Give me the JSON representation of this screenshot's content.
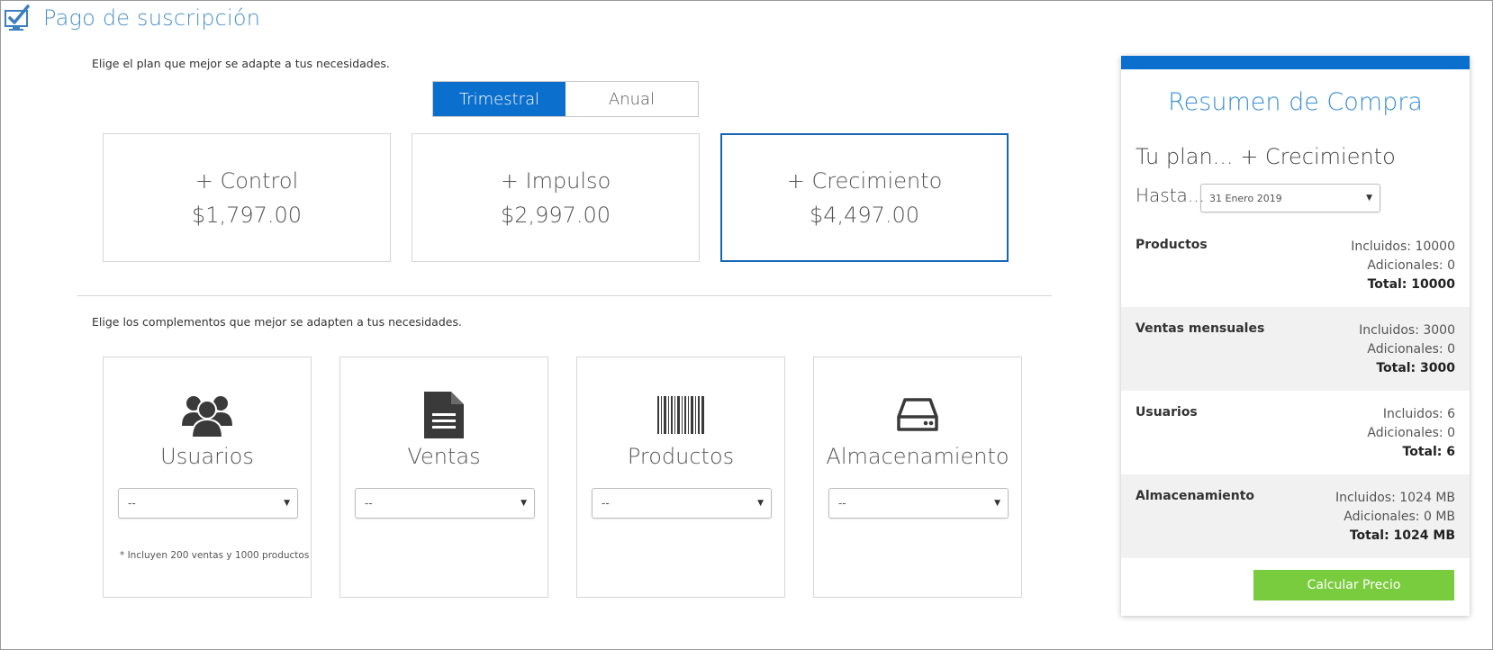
{
  "header": {
    "title": "Pago de suscripción"
  },
  "plans_section": {
    "prompt": "Elige el plan que mejor se adapte a tus necesidades.",
    "billing_toggle": [
      {
        "label": "Trimestral",
        "active": true
      },
      {
        "label": "Anual",
        "active": false
      }
    ],
    "plans": [
      {
        "name": "+ Control",
        "price": "$1,797.00",
        "selected": false
      },
      {
        "name": "+ Impulso",
        "price": "$2,997.00",
        "selected": false
      },
      {
        "name": "+ Crecimiento",
        "price": "$4,497.00",
        "selected": true
      }
    ]
  },
  "addons_section": {
    "prompt": "Elige los complementos que mejor se adapten a tus necesidades.",
    "addons": [
      {
        "name": "Usuarios",
        "icon": "users-icon",
        "selected_value": "--",
        "note": "* Incluyen 200 ventas y 1000 productos"
      },
      {
        "name": "Ventas",
        "icon": "document-icon",
        "selected_value": "--",
        "note": ""
      },
      {
        "name": "Productos",
        "icon": "barcode-icon",
        "selected_value": "--",
        "note": ""
      },
      {
        "name": "Almacenamiento",
        "icon": "hard-drive-icon",
        "selected_value": "--",
        "note": ""
      }
    ]
  },
  "summary": {
    "title": "Resumen de Compra",
    "plan_line": "Tu plan... + Crecimiento",
    "hasta_label": "Hasta...",
    "date_value": "31 Enero 2019",
    "rows": [
      {
        "label": "Productos",
        "included": "Incluidos: 10000",
        "additional": "Adicionales: 0",
        "total": "Total: 10000"
      },
      {
        "label": "Ventas mensuales",
        "included": "Incluidos: 3000",
        "additional": "Adicionales: 0",
        "total": "Total: 3000"
      },
      {
        "label": "Usuarios",
        "included": "Incluidos: 6",
        "additional": "Adicionales: 0",
        "total": "Total: 6"
      },
      {
        "label": "Almacenamiento",
        "included": "Incluidos: 1024 MB",
        "additional": "Adicionales: 0 MB",
        "total": "Total: 1024 MB"
      }
    ],
    "calculate_button": "Calcular Precio"
  },
  "colors": {
    "accent_blue": "#0b6fce",
    "title_blue": "#3a8fd4",
    "button_green": "#79cc3d",
    "shaded_row": "#f1f1f1"
  }
}
